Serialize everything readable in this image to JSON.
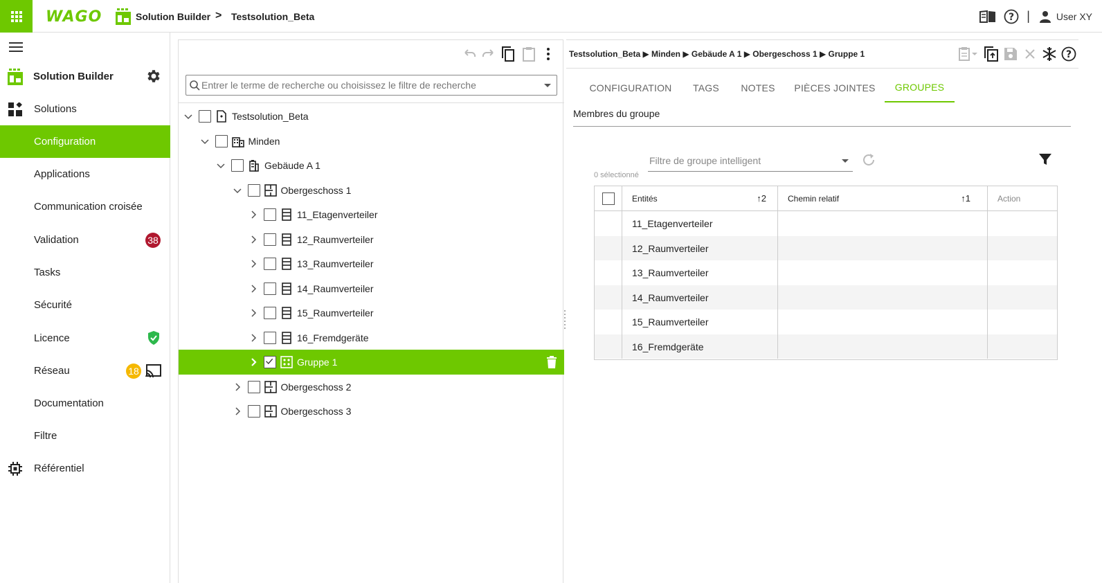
{
  "colors": {
    "accent": "#6ec800",
    "badge_red": "#b0182f",
    "badge_yellow": "#f5b800"
  },
  "topbar": {
    "logo": "WAGO",
    "app_name": "Solution Builder",
    "separator": ">",
    "solution": "Testsolution_Beta",
    "user": "User XY",
    "pipe": "|"
  },
  "leftnav": {
    "app_title": "Solution Builder",
    "items": [
      {
        "label": "Solutions",
        "icon": "dashboard-icon"
      },
      {
        "label": "Configuration",
        "active": true
      },
      {
        "label": "Applications"
      },
      {
        "label": "Communication croisée"
      },
      {
        "label": "Validation",
        "badge": "38"
      },
      {
        "label": "Tasks"
      },
      {
        "label": "Sécurité"
      },
      {
        "label": "Licence",
        "icon_right": "shield-check-icon"
      },
      {
        "label": "Réseau",
        "badge": "18",
        "icon_right": "cast-icon"
      },
      {
        "label": "Documentation"
      },
      {
        "label": "Filtre"
      },
      {
        "label": "Référentiel",
        "icon": "chip-icon"
      }
    ]
  },
  "tree": {
    "search_placeholder": "Entrer le terme de recherche ou choisissez le filtre de recherche",
    "nodes": [
      {
        "label": "Testsolution_Beta",
        "icon": "solution-file-icon"
      },
      {
        "label": "Minden",
        "icon": "building-icon"
      },
      {
        "label": "Gebäude A 1",
        "icon": "office-building-icon"
      },
      {
        "label": "Obergeschoss 1",
        "icon": "floorplan-icon"
      },
      {
        "label": "11_Etagenverteiler",
        "icon": "cabinet-icon"
      },
      {
        "label": "12_Raumverteiler",
        "icon": "cabinet-icon"
      },
      {
        "label": "13_Raumverteiler",
        "icon": "cabinet-icon"
      },
      {
        "label": "14_Raumverteiler",
        "icon": "cabinet-icon"
      },
      {
        "label": "15_Raumverteiler",
        "icon": "cabinet-icon"
      },
      {
        "label": "16_Fremdgeräte",
        "icon": "cabinet-icon"
      },
      {
        "label": "Gruppe 1",
        "icon": "group-icon",
        "selected": true,
        "checked": true
      },
      {
        "label": "Obergeschoss 2",
        "icon": "floorplan-icon"
      },
      {
        "label": "Obergeschoss 3",
        "icon": "floorplan-icon"
      }
    ]
  },
  "detail": {
    "breadcrumb": "Testsolution_Beta ▶ Minden ▶ Gebäude A 1 ▶ Obergeschoss 1 ▶ Gruppe 1",
    "tabs": [
      {
        "label": "CONFIGURATION"
      },
      {
        "label": "TAGS"
      },
      {
        "label": "NOTES"
      },
      {
        "label": "PIÈCES JOINTES"
      },
      {
        "label": "GROUPES",
        "active": true
      }
    ],
    "section_title": "Membres du groupe",
    "smart_filter_placeholder": "Filtre de groupe intelligent",
    "selected_count": "0 sélectionné",
    "columns": {
      "entities": "Entités",
      "entities_sort": "↑2",
      "path": "Chemin relatif",
      "path_sort": "↑1",
      "action": "Action"
    },
    "rows": [
      "11_Etagenverteiler",
      "12_Raumverteiler",
      "13_Raumverteiler",
      "14_Raumverteiler",
      "15_Raumverteiler",
      "16_Fremdgeräte"
    ]
  }
}
